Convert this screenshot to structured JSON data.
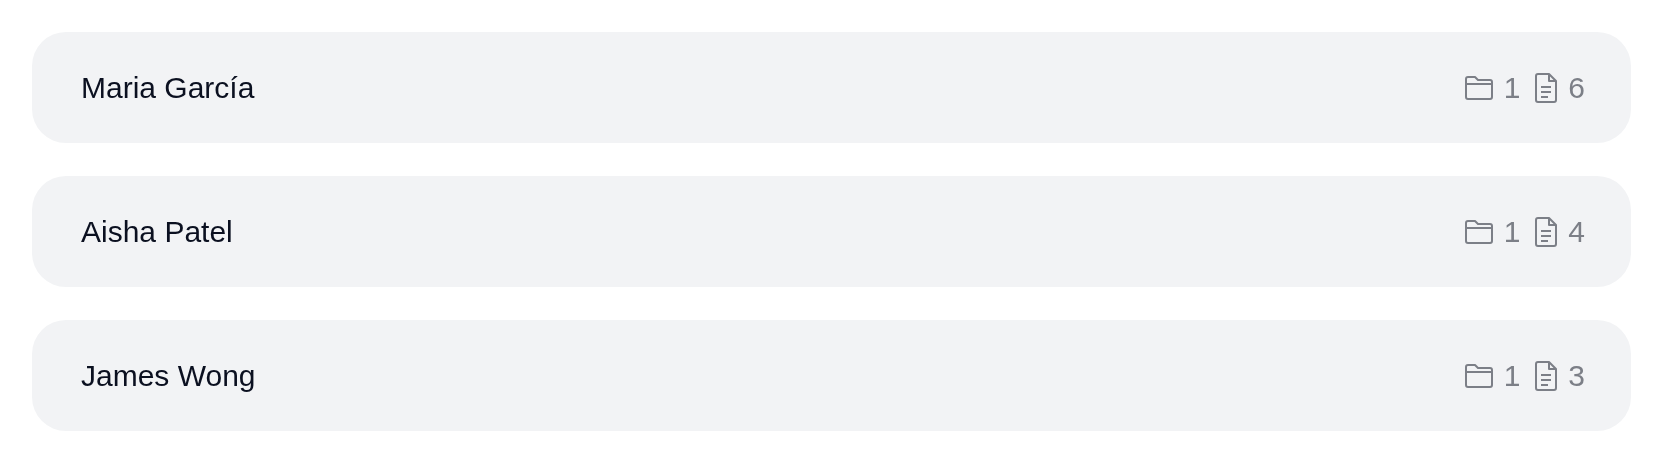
{
  "people": [
    {
      "name": "Maria García",
      "folders": "1",
      "documents": "6"
    },
    {
      "name": "Aisha Patel",
      "folders": "1",
      "documents": "4"
    },
    {
      "name": "James Wong",
      "folders": "1",
      "documents": "3"
    }
  ]
}
